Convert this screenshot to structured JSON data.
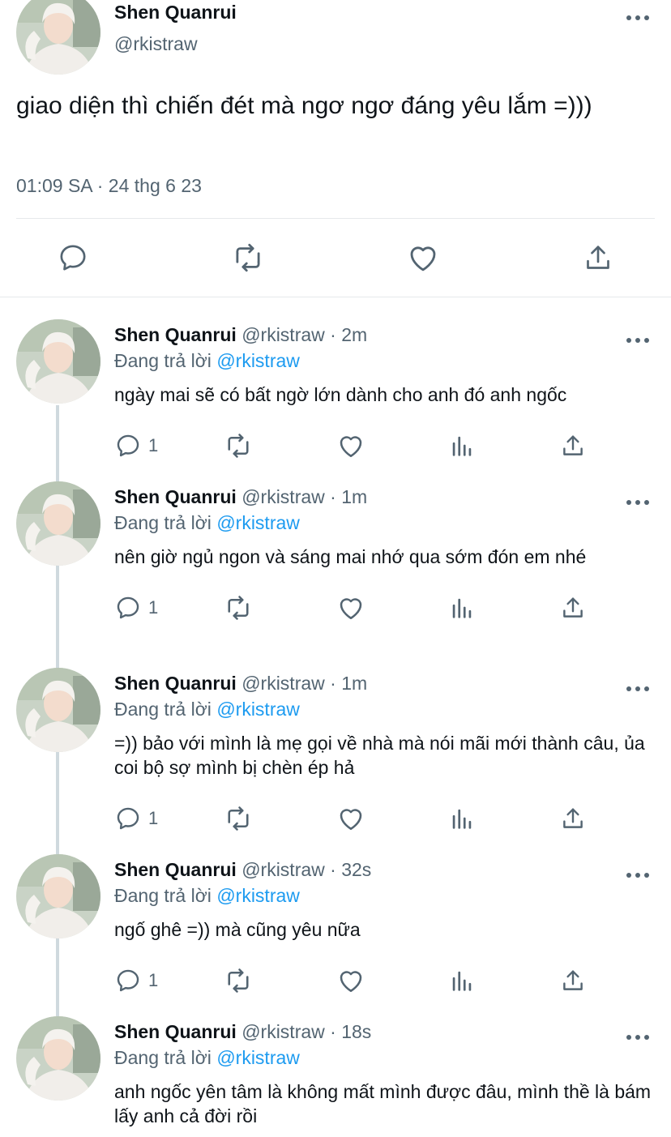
{
  "main_tweet": {
    "author_name": "Shen Quanrui",
    "author_handle": "@rkistraw",
    "text": "giao diện thì chiến đét mà ngơ ngơ đáng yêu lắm =)))",
    "timestamp": "01:09 SA · 24 thg 6 23",
    "actions": [
      "reply-icon",
      "retweet-icon",
      "like-icon",
      "share-icon"
    ]
  },
  "replies": [
    {
      "author_name": "Shen Quanrui",
      "meta": "@rkistraw · 2m",
      "replying_prefix": "Đang trả lời",
      "replying_handle": "@rkistraw",
      "text": "ngày mai sẽ có bất ngờ lớn dành cho anh đó anh ngốc",
      "reply_count": "1"
    },
    {
      "author_name": "Shen Quanrui",
      "meta": "@rkistraw · 1m",
      "replying_prefix": "Đang trả lời",
      "replying_handle": "@rkistraw",
      "text": "nên giờ ngủ ngon và sáng mai nhớ qua sớm đón em nhé",
      "reply_count": "1"
    },
    {
      "author_name": "Shen Quanrui",
      "meta": "@rkistraw · 1m",
      "replying_prefix": "Đang trả lời",
      "replying_handle": "@rkistraw",
      "text": "=)) bảo với mình là mẹ gọi về nhà mà nói mãi mới thành câu, ủa coi bộ sợ mình bị chèn ép hả",
      "reply_count": "1"
    },
    {
      "author_name": "Shen Quanrui",
      "meta": "@rkistraw · 32s",
      "replying_prefix": "Đang trả lời",
      "replying_handle": "@rkistraw",
      "text": "ngố ghê =)) mà cũng yêu nữa",
      "reply_count": "1"
    },
    {
      "author_name": "Shen Quanrui",
      "meta": "@rkistraw · 18s",
      "replying_prefix": "Đang trả lời",
      "replying_handle": "@rkistraw",
      "text": "anh ngốc yên tâm là không mất mình được đâu, mình thề là bám lấy anh cả đời rồi",
      "reply_count": ""
    }
  ],
  "colors": {
    "text": "#0f1419",
    "secondary": "#536471",
    "link": "#1d9bf0",
    "divider": "#e6e9eb",
    "thread_line": "#cfd9de"
  }
}
